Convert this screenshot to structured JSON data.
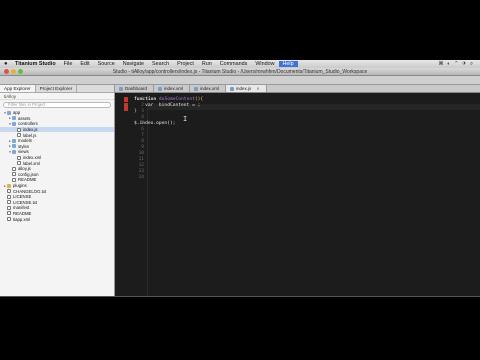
{
  "menubar": {
    "items": [
      "Titanium Studio",
      "File",
      "Edit",
      "Source",
      "Navigate",
      "Search",
      "Project",
      "Run",
      "Commands",
      "Window",
      "Help"
    ],
    "status_glyphs": "⌘ ◐ ⌃ ✈ ⌕"
  },
  "window": {
    "title": "Studio - tiAlloy/app/controllers/index.js - Titanium Studio - /Users/mrwhfen/Documents/Titanium_Studio_Workspace"
  },
  "sidebar": {
    "tabs": [
      "App Explorer",
      "Project Explorer"
    ],
    "project_selector": "tiAlloy",
    "filter_placeholder": "Filter files in Project",
    "tree": [
      {
        "label": "app",
        "depth": 0,
        "icon": "folder",
        "arrow": "▾"
      },
      {
        "label": "assets",
        "depth": 1,
        "icon": "folder",
        "arrow": "▸"
      },
      {
        "label": "controllers",
        "depth": 1,
        "icon": "folder",
        "arrow": "▾"
      },
      {
        "label": "index.js",
        "depth": 2,
        "icon": "file",
        "arrow": "",
        "selected": true
      },
      {
        "label": "label.js",
        "depth": 2,
        "icon": "file",
        "arrow": ""
      },
      {
        "label": "models",
        "depth": 1,
        "icon": "folder",
        "arrow": "▸"
      },
      {
        "label": "styles",
        "depth": 1,
        "icon": "folder",
        "arrow": "▸"
      },
      {
        "label": "views",
        "depth": 1,
        "icon": "folder",
        "arrow": "▾"
      },
      {
        "label": "index.xml",
        "depth": 2,
        "icon": "file",
        "arrow": ""
      },
      {
        "label": "label.xml",
        "depth": 2,
        "icon": "file",
        "arrow": ""
      },
      {
        "label": "alloy.js",
        "depth": 1,
        "icon": "file",
        "arrow": ""
      },
      {
        "label": "config.json",
        "depth": 1,
        "icon": "file",
        "arrow": ""
      },
      {
        "label": "README",
        "depth": 1,
        "icon": "file",
        "arrow": ""
      },
      {
        "label": "plugins",
        "depth": 0,
        "icon": "folder-y",
        "arrow": "▸"
      },
      {
        "label": "CHANGELOG.txt",
        "depth": 0,
        "icon": "file",
        "arrow": ""
      },
      {
        "label": "LICENSE",
        "depth": 0,
        "icon": "file",
        "arrow": ""
      },
      {
        "label": "LICENSE.txt",
        "depth": 0,
        "icon": "file",
        "arrow": ""
      },
      {
        "label": "manifest",
        "depth": 0,
        "icon": "file",
        "arrow": ""
      },
      {
        "label": "README",
        "depth": 0,
        "icon": "file",
        "arrow": ""
      },
      {
        "label": "tiapp.xml",
        "depth": 0,
        "icon": "file",
        "arrow": ""
      }
    ]
  },
  "editor": {
    "tabs": [
      {
        "label": "Dashboard",
        "active": false
      },
      {
        "label": "index.xml",
        "active": false
      },
      {
        "label": "index.xml",
        "active": false
      },
      {
        "label": "index.js",
        "active": true
      }
    ],
    "code": {
      "line1_kw": "function",
      "line1_name": " doSomeContent",
      "line1_brace": "(){",
      "line2": "    var  bindContent = ;",
      "line3": "}",
      "line5": "$.index.open();"
    },
    "line_numbers": [
      "1",
      "2",
      "3",
      "4",
      "5",
      "6",
      "7",
      "8",
      "9",
      "10",
      "11",
      "12",
      "13",
      "14"
    ]
  }
}
